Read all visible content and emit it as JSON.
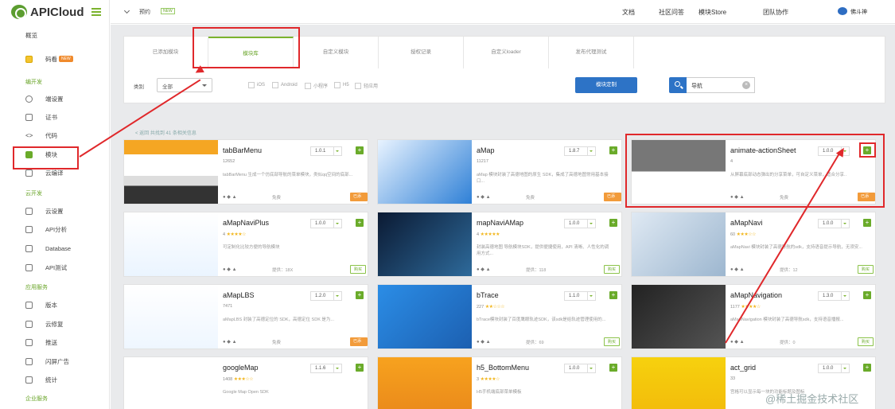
{
  "app": {
    "logo_text": "APICloud"
  },
  "topbar": {
    "project": "预约",
    "project_tag": "NEW",
    "nav": [
      "文档",
      "社区问答",
      "模块Store",
      "团队协作"
    ],
    "user": "佛斗神"
  },
  "sidebar": {
    "overview": "概览",
    "code_label": "码看",
    "code_badge": "NEW",
    "sections": [
      "编开发",
      "云开发",
      "应用服务",
      "企业服务"
    ],
    "dev_items": [
      "端设置",
      "证书",
      "代码",
      "模块",
      "云编译"
    ],
    "cloud_items": [
      "云设置",
      "API分析",
      "Database",
      "API测试"
    ],
    "service_items": [
      "版本",
      "云修复",
      "推送",
      "闪屏广告",
      "统计"
    ]
  },
  "tabs": [
    "已添加模块",
    "模块库",
    "自定义模块",
    "授权记录",
    "自定义loader",
    "发布代理测试"
  ],
  "active_tab": 1,
  "filter": {
    "label": "类别",
    "select_value": "全部",
    "checkboxes": [
      "iOS",
      "Android",
      "小程序",
      "H5",
      "轻应用"
    ],
    "custom_button": "模块定制",
    "search_value": "导航"
  },
  "result_info": "< 返回  共找到 41 条相关信息",
  "cards": [
    {
      "name": "tabBarMenu",
      "version": "1.0.1",
      "meta": "12652",
      "stars": "",
      "desc": "tabBarMenu 生成一个仿底部导航的菜单模块，类似qq空间的底部...",
      "author": "免费",
      "badge": "已添加",
      "badge_style": "orange",
      "thumb": "apicloud"
    },
    {
      "name": "aMap",
      "version": "1.8.7",
      "meta": "11217",
      "stars": "",
      "desc": "aMap 模块封装了高德地图的原生 SDK，集成了高德地图常用基本接口...",
      "author": "免费",
      "badge": "已添加",
      "badge_style": "orange",
      "thumb": "sdk-blue"
    },
    {
      "name": "animate-actionSheet",
      "version": "1.0.0",
      "meta": "4",
      "stars": "",
      "desc": "从屏幕底部动态弹出的分享菜单，可自定义菜单，适合分享..",
      "author": "免费",
      "badge": "已添加",
      "badge_style": "orange",
      "thumb": "sheet"
    },
    {
      "name": "aMapNaviPlus",
      "version": "1.0.0",
      "meta": "4",
      "stars": "★★★★☆",
      "desc": "可定制化比较方便的导航模块",
      "author": "提供：18X",
      "badge": "购买",
      "badge_style": "green",
      "thumb": "navi-plus"
    },
    {
      "name": "mapNaviAMap",
      "version": "1.0.0",
      "meta": "4",
      "stars": "★★★★★",
      "desc": "封装高德地图 导航模块SDK，提供便捷使用，API 清晰、人性化的调用方式...",
      "author": "提供：118",
      "badge": "购买",
      "badge_style": "green",
      "thumb": "dark-city"
    },
    {
      "name": "aMapNavi",
      "version": "1.0.0",
      "meta": "60",
      "stars": "★★★☆☆",
      "desc": "aMapNavi 模块封装了高德导航的sdk，支持语音提示导航，无须安...",
      "author": "提供：12",
      "badge": "购买",
      "badge_style": "green",
      "thumb": "phone-map"
    },
    {
      "name": "aMapLBS",
      "version": "1.2.0",
      "meta": "7471",
      "stars": "",
      "desc": "aMapLBS 封装了高德定位的 SDK，高德定位 SDK 是为...",
      "author": "免费",
      "badge": "已添加",
      "badge_style": "orange",
      "thumb": "lbs"
    },
    {
      "name": "bTrace",
      "version": "1.1.0",
      "meta": "227",
      "stars": "★★☆☆☆",
      "desc": "bTrace模块封装了百度鹰眼轨迹SDK，该sdk是给轨迹管理使用的...",
      "author": "提供：69",
      "badge": "购买",
      "badge_style": "green",
      "thumb": "trace"
    },
    {
      "name": "aMapNavigation",
      "version": "1.3.0",
      "meta": "1177",
      "stars": "★★★★☆",
      "desc": "aMapNavigation 模块封装了高德导航sdk，支持语音播报...",
      "author": "提供：0",
      "badge": "购买",
      "badge_style": "green",
      "thumb": "phone-dark"
    },
    {
      "name": "googleMap",
      "version": "1.1.6",
      "meta": "1408",
      "stars": "★★★☆☆",
      "desc": "Google Map Open SDK",
      "author": "",
      "badge": "",
      "badge_style": "",
      "thumb": "gmap"
    },
    {
      "name": "h5_BottomMenu",
      "version": "1.0.0",
      "meta": "3",
      "stars": "★★★★☆",
      "desc": "H5手机端底部菜单模板",
      "author": "",
      "badge": "",
      "badge_style": "",
      "thumb": "orange"
    },
    {
      "name": "act_grid",
      "version": "1.0.0",
      "meta": "33",
      "stars": "",
      "desc": "宫格可以显示每一块的功能标题及图标",
      "author": "",
      "badge": "",
      "badge_style": "",
      "thumb": "grid"
    }
  ],
  "watermark": "@稀土掘金技术社区",
  "colors": {
    "accent": "#7bb32e",
    "primary": "#2d73c6",
    "highlight": "#e0282b",
    "badge_orange": "#f29b3a"
  }
}
